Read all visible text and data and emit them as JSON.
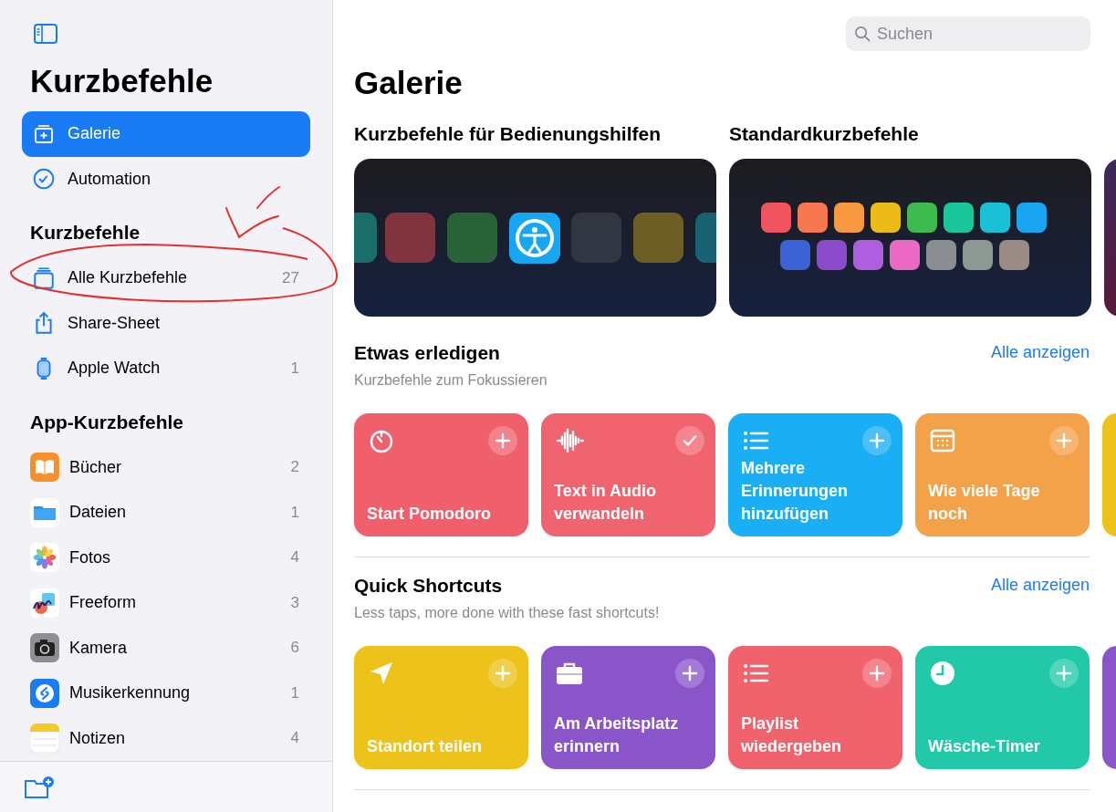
{
  "sidebar": {
    "title": "Kurzbefehle",
    "nav": [
      {
        "label": "Galerie",
        "selected": true
      },
      {
        "label": "Automation",
        "selected": false
      }
    ],
    "sections": [
      {
        "title": "Kurzbefehle",
        "items": [
          {
            "label": "Alle Kurzbefehle",
            "count": "27",
            "selected": false
          },
          {
            "label": "Share-Sheet",
            "selected": false
          },
          {
            "label": "Apple Watch",
            "count": "1",
            "selected": false
          }
        ]
      },
      {
        "title": "App-Kurzbefehle",
        "items": [
          {
            "label": "Bücher",
            "count": "2",
            "selected": false
          },
          {
            "label": "Dateien",
            "count": "1",
            "selected": false
          },
          {
            "label": "Fotos",
            "count": "4",
            "selected": false
          },
          {
            "label": "Freeform",
            "count": "3",
            "selected": false
          },
          {
            "label": "Kamera",
            "count": "6",
            "selected": false
          },
          {
            "label": "Musikerkennung",
            "count": "1",
            "selected": false
          },
          {
            "label": "Notizen",
            "count": "4",
            "selected": false
          }
        ]
      }
    ]
  },
  "search": {
    "placeholder": "Suchen"
  },
  "page_title": "Galerie",
  "collections": [
    {
      "title": "Kurzbefehle für Bedienungshilfen"
    },
    {
      "title": "Standardkurzbefehle"
    }
  ],
  "groups": [
    {
      "title": "Etwas erledigen",
      "subtitle": "Kurzbefehle zum Fokussieren",
      "link": "Alle anzeigen",
      "cards": [
        {
          "label": "Start Pomodoro",
          "color": "#ef5f6c",
          "added": false
        },
        {
          "label": "Text in Audio verwandeln",
          "color": "#f0646f",
          "added": true
        },
        {
          "label": "Mehrere Erinnerungen hinzufügen",
          "color": "#1aaef5",
          "added": false
        },
        {
          "label": "Wie viele Tage noch",
          "color": "#f4a24a",
          "added": false
        }
      ]
    },
    {
      "title": "Quick Shortcuts",
      "subtitle": "Less taps, more done with these fast shortcuts!",
      "link": "Alle anzeigen",
      "cards": [
        {
          "label": "Standort teilen",
          "color": "#ecc21b",
          "added": false
        },
        {
          "label": "Am Arbeitsplatz erinnern",
          "color": "#8a55c9",
          "added": false
        },
        {
          "label": "Playlist wiedergeben",
          "color": "#f0636d",
          "added": false
        },
        {
          "label": "Wäsche-Timer",
          "color": "#22c9a8",
          "added": false
        }
      ]
    }
  ]
}
